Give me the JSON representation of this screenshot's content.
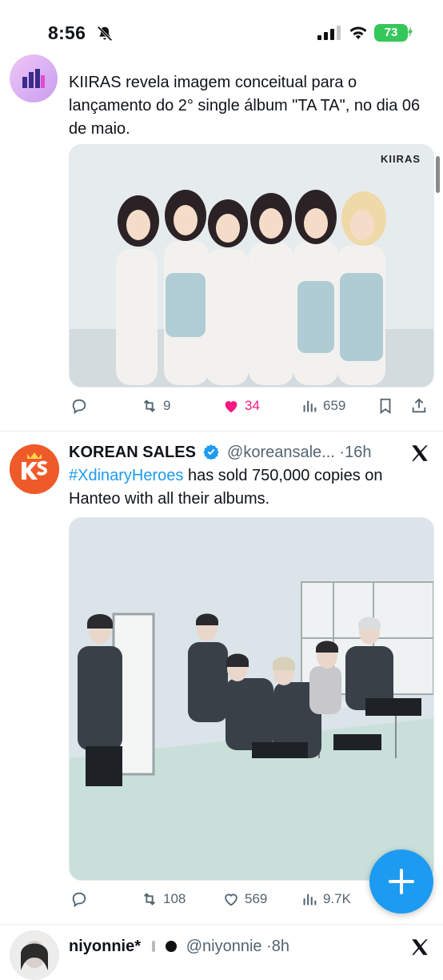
{
  "status_bar": {
    "time": "8:56",
    "battery": "73",
    "colors": {
      "battery": "#35c759"
    }
  },
  "tweet1": {
    "text": "KIIRAS revela imagem conceitual para o lançamento do 2° single álbum \"TA TA\", no dia 06 de maio.",
    "image_logo": "KIIRAS",
    "actions": {
      "replies": "",
      "retweets": "9",
      "likes": "34",
      "views": "659"
    },
    "liked": true
  },
  "tweet2": {
    "name": "KOREAN SALES",
    "handle": "@koreansale...",
    "time": "·16h",
    "hashtag": "#XdinaryHeroes",
    "text": " has sold 750,000 copies on Hanteo with all their albums.",
    "actions": {
      "replies": "",
      "retweets": "108",
      "likes": "569",
      "views": "9.7K"
    }
  },
  "tweet3": {
    "name": "niyonnie*",
    "handle": "@niyonnie",
    "time": "·8h"
  },
  "colors": {
    "accent": "#1d9bf0",
    "like": "#f91880",
    "muted": "#536471"
  }
}
